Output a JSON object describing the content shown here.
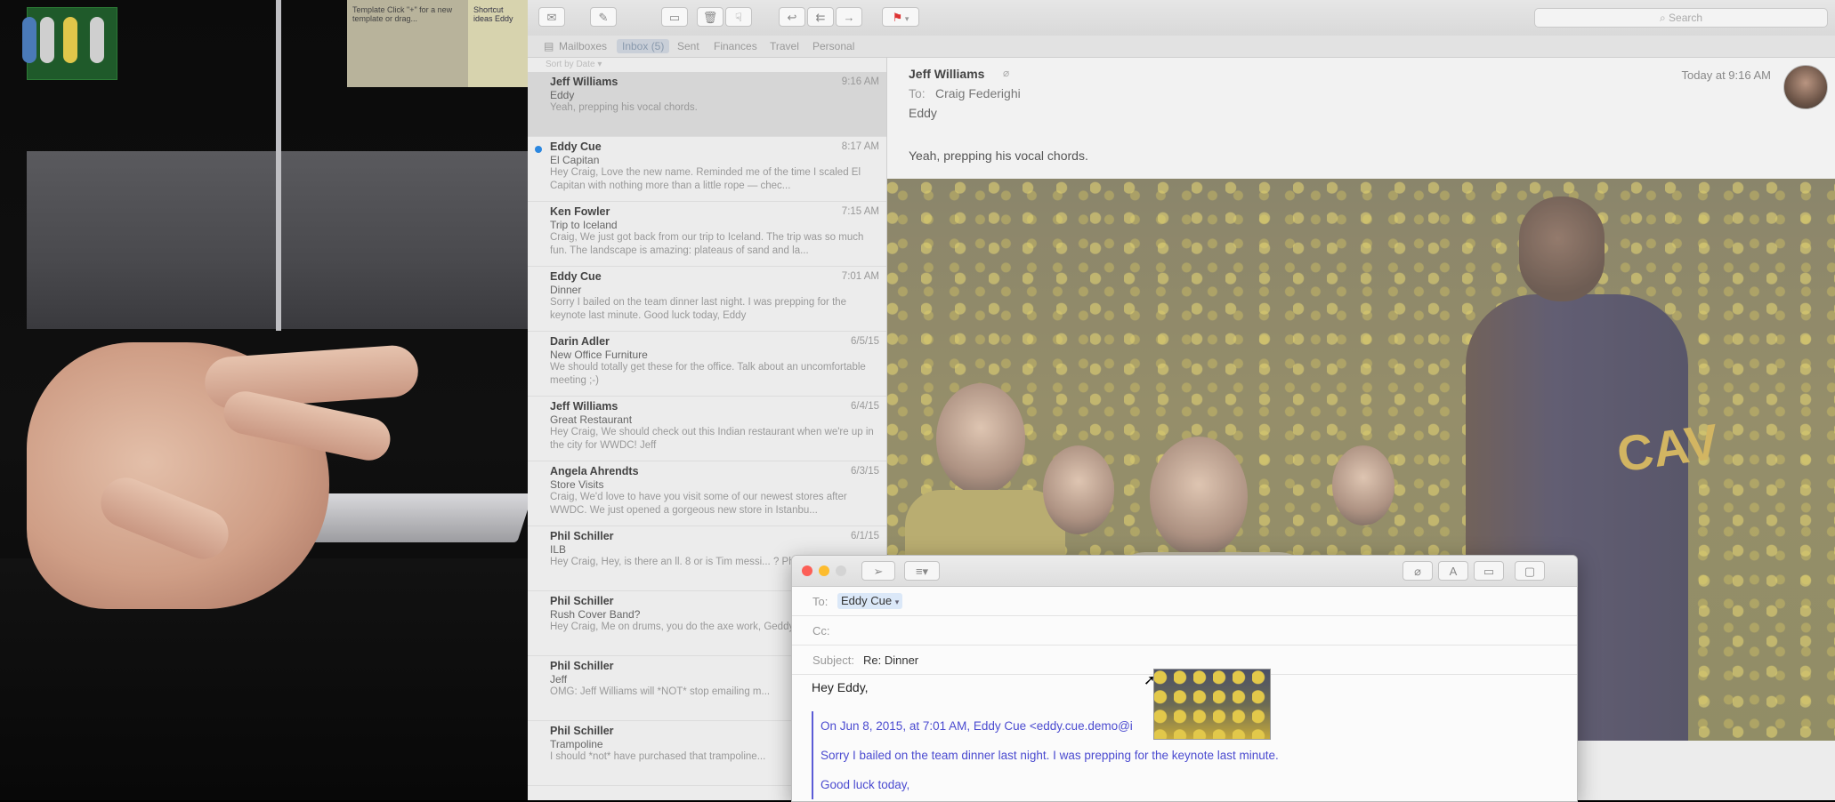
{
  "stage": {
    "note1": "Template\nClick \"+\" for a new template or drag...",
    "note2": "Shortcut ideas\nEddy"
  },
  "toolbar": {
    "search_placeholder": "Search",
    "buttons": [
      "get-mail",
      "compose",
      "archive",
      "trash",
      "junk",
      "reply",
      "reply-all",
      "forward",
      "flag"
    ]
  },
  "favorites": {
    "items": [
      {
        "label": "Mailboxes"
      },
      {
        "label": "Inbox (5)",
        "active": true
      },
      {
        "label": "Sent"
      },
      {
        "label": "Finances"
      },
      {
        "label": "Travel"
      },
      {
        "label": "Personal"
      }
    ]
  },
  "message_list": {
    "sort_label": "Sort by Date",
    "messages": [
      {
        "from": "Jeff Williams",
        "date": "9:16 AM",
        "subject": "Eddy",
        "preview": "Yeah, prepping his vocal chords.",
        "selected": true
      },
      {
        "from": "Eddy Cue",
        "date": "8:17 AM",
        "subject": "El Capitan",
        "preview": "Hey Craig, Love the new name. Reminded me of the time I scaled El Capitan with nothing more than a little rope — chec...",
        "unread": true
      },
      {
        "from": "Ken Fowler",
        "date": "7:15 AM",
        "subject": "Trip to Iceland",
        "preview": "Craig, We just got back from our trip to Iceland. The trip was so much fun. The landscape is amazing: plateaus of sand and la..."
      },
      {
        "from": "Eddy Cue",
        "date": "7:01 AM",
        "subject": "Dinner",
        "preview": "Sorry I bailed on the team dinner last night. I was prepping for the keynote last minute. Good luck today, Eddy"
      },
      {
        "from": "Darin Adler",
        "date": "6/5/15",
        "subject": "New Office Furniture",
        "preview": "We should totally get these for the office. Talk about an uncomfortable meeting ;-)"
      },
      {
        "from": "Jeff Williams",
        "date": "6/4/15",
        "subject": "Great Restaurant",
        "preview": "Hey Craig, We should check out this Indian restaurant when we're up in the city for WWDC! Jeff"
      },
      {
        "from": "Angela Ahrendts",
        "date": "6/3/15",
        "subject": "Store Visits",
        "preview": "Craig, We'd love to have you visit some of our newest stores after WWDC. We just opened a gorgeous new store in Istanbu..."
      },
      {
        "from": "Phil Schiller",
        "date": "6/1/15",
        "subject": "ILB",
        "preview": "Hey Craig, Hey, is there an ll. 8 or is Tim messi... ? Phil"
      },
      {
        "from": "Phil Schiller",
        "date": "",
        "subject": "Rush Cover Band?",
        "preview": "Hey Craig, Me on drums, you do the axe work, Geddy Lee? Phil"
      },
      {
        "from": "Phil Schiller",
        "date": "",
        "subject": "Jeff",
        "preview": "OMG: Jeff Williams will *NOT* stop emailing m..."
      },
      {
        "from": "Phil Schiller",
        "date": "",
        "subject": "Trampoline",
        "preview": "I should *not* have purchased that trampoline..."
      }
    ]
  },
  "viewer": {
    "from": "Jeff Williams",
    "to_label": "To:",
    "to": "Craig Federighi",
    "subject": "Eddy",
    "date": "Today at 9:16 AM",
    "body": "Yeah, prepping his vocal chords."
  },
  "compose": {
    "to_label": "To:",
    "to_token": "Eddy Cue",
    "cc_label": "Cc:",
    "subject_label": "Subject:",
    "subject": "Re: Dinner",
    "greeting": "Hey Eddy,",
    "quote_header": "On Jun 8, 2015, at 7:01 AM, Eddy Cue <eddy.cue.demo@i",
    "quote_line1": "Sorry I bailed on the team dinner last night.  I was prepping for the keynote last minute.",
    "quote_line2": "Good luck today,"
  }
}
